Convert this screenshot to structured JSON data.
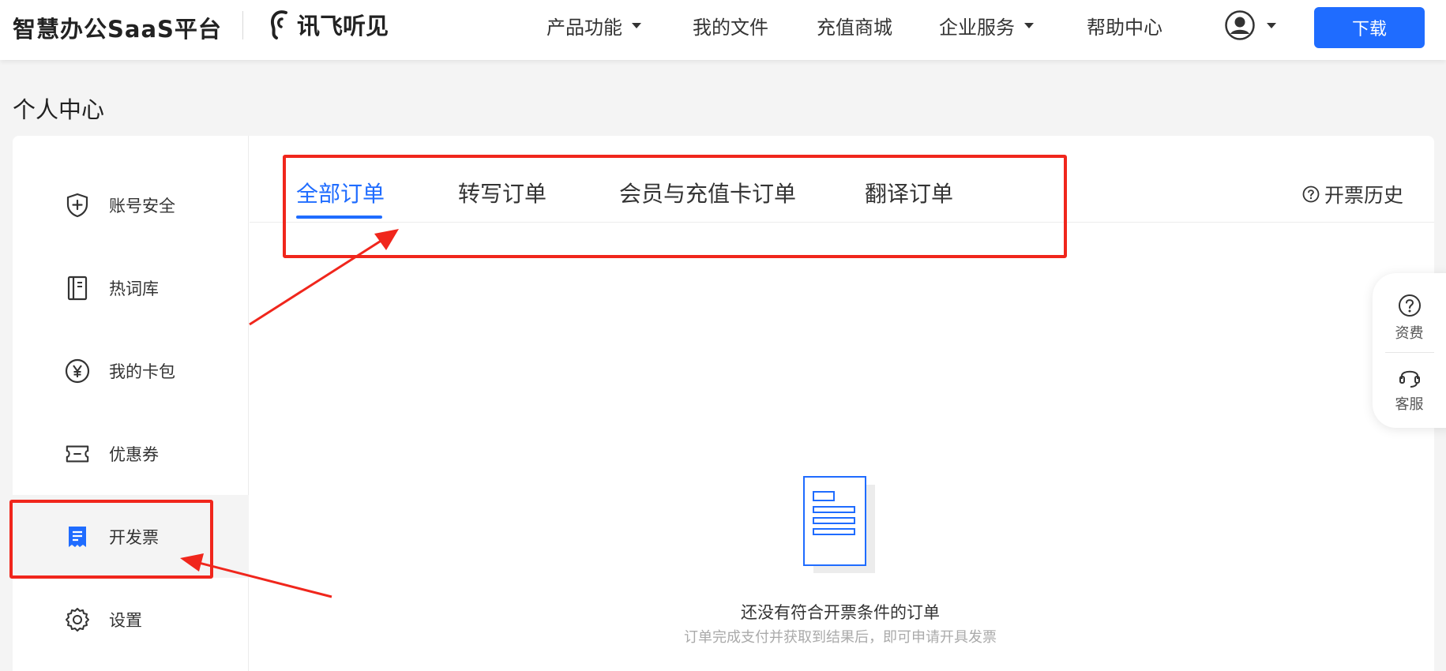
{
  "header": {
    "brand": "智慧办公SaaS平台",
    "logo_text": "讯飞听见",
    "nav": [
      {
        "label": "产品功能",
        "has_dropdown": true
      },
      {
        "label": "我的文件",
        "has_dropdown": false
      },
      {
        "label": "充值商城",
        "has_dropdown": false
      },
      {
        "label": "企业服务",
        "has_dropdown": true
      },
      {
        "label": "帮助中心",
        "has_dropdown": false
      }
    ],
    "download_label": "下载"
  },
  "page_title": "个人中心",
  "sidebar": {
    "items": [
      {
        "label": "账号安全",
        "icon": "shield-icon"
      },
      {
        "label": "热词库",
        "icon": "notebook-icon"
      },
      {
        "label": "我的卡包",
        "icon": "yen-icon"
      },
      {
        "label": "优惠券",
        "icon": "coupon-icon"
      },
      {
        "label": "开发票",
        "icon": "invoice-icon",
        "active": true
      },
      {
        "label": "设置",
        "icon": "gear-icon"
      }
    ]
  },
  "tabs": [
    {
      "label": "全部订单",
      "active": true
    },
    {
      "label": "转写订单"
    },
    {
      "label": "会员与充值卡订单"
    },
    {
      "label": "翻译订单"
    }
  ],
  "invoice_history_label": "开票历史",
  "empty_state": {
    "title": "还没有符合开票条件的订单",
    "subtitle": "订单完成支付并获取到结果后，即可申请开具发票"
  },
  "float_panel": {
    "items": [
      {
        "label": "资费",
        "icon": "question-icon"
      },
      {
        "label": "客服",
        "icon": "headset-icon"
      }
    ]
  },
  "colors": {
    "accent": "#1f6cff",
    "annotation": "#f0261c"
  }
}
